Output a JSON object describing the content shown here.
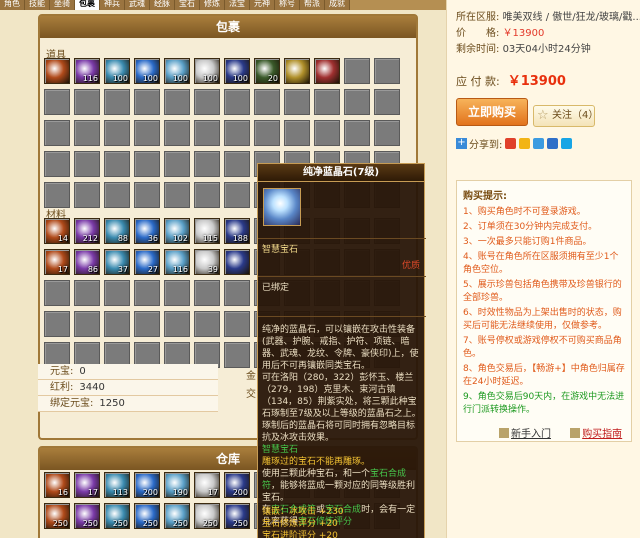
{
  "tabs": [
    "角色",
    "技能",
    "坐骑",
    "包裹",
    "神兵",
    "武魂",
    "经脉",
    "宝石",
    "修炼",
    "法宝",
    "元神",
    "称号",
    "帮派",
    "成就"
  ],
  "active_tab": 3,
  "package": {
    "title": "包裹",
    "label_props": "道具",
    "label_materials": "材料",
    "props_counts": [
      "",
      "116",
      "100",
      "100",
      "100",
      "100",
      "100",
      "20",
      "",
      "",
      "",
      ""
    ],
    "materials_counts": [
      "14",
      "212",
      "88",
      "36",
      "102",
      "115",
      "188",
      "",
      "",
      "",
      "",
      "",
      "17",
      "86",
      "37",
      "27",
      "116",
      "39",
      "",
      "",
      "",
      "",
      "",
      ""
    ],
    "currency": {
      "yuanbao_label": "元宝:",
      "yuanbao": "0",
      "hongli_label": "红利:",
      "hongli": "3440",
      "bind_label": "绑定元宝:",
      "bind": "1250"
    },
    "extra_labels": [
      "金",
      "交"
    ]
  },
  "store": {
    "title": "仓库",
    "counts": [
      "16",
      "17",
      "113",
      "200",
      "190",
      "17",
      "200",
      "",
      "",
      "",
      "",
      "",
      "250",
      "250",
      "250",
      "250",
      "250",
      "250",
      "250",
      "",
      "",
      "",
      "",
      ""
    ]
  },
  "tooltip": {
    "title": "纯净蓝晶石(7级)",
    "subtitle": "智慧宝石",
    "quality": "优质",
    "bind": "已绑定",
    "desc_1": "纯净的蓝晶石，可以镶嵌在攻击性装备(武器、护腕、戒指、护符、项链、暗器、武魂、龙纹、令牌、豪侠印)上，使用后不可再镶嵌同类宝石。",
    "desc_2": "可在洛阳（280，322）彭怀玉、楼兰（279，198）克里木、束河古镇（134，85）荆紫实处，将三颗此种宝石琢制至7级及以上等级的蓝晶石之上。琢制后的蓝晶石将可同时拥有忽略目标抗及冰攻击效果。",
    "gem_type": "智慧宝石",
    "warn": "雕琢过的宝石不能再雕琢。",
    "desc_3_a": "使用三颗此种宝石，和一个",
    "desc_3_b": "，能够将蓝成一颗对应的同等级胜利宝石。",
    "desc_4_a": "在",
    "desc_4_b": "或",
    "desc_4_c": "时，会有一定几率获得",
    "item_fuse": "宝石合成符",
    "item_1": "宝石合成符",
    "item_2": "宝石合成",
    "item_score": "宝石修炼评分",
    "stat_1": "镶嵌：冰攻击 +230",
    "stat_2": "宝石修炼评分 +20",
    "stat_3": "宝石进阶评分 +20"
  },
  "listing": {
    "server_label": "所在区服:",
    "server": "唯美双线 / 傲世/狂龙/玻璃/戳...",
    "price_label": "价　　格:",
    "price": "￥13900",
    "time_label": "剩余时间:",
    "time": "03天04小时24分钟",
    "pay_label": "应 付 款:",
    "pay": "￥13900",
    "buy_label": "立即购买",
    "fav_label": "关注（4）",
    "share_label": "分享到:"
  },
  "buy_tips": {
    "title": "购买提示:",
    "items": [
      "1、购买角色时不可登录游戏。",
      "2、订单须在30分钟内完成支付。",
      "3、一次最多只能订购1件商品。",
      "4、账号在角色所在区服须拥有至少1个角色空位。",
      "5、展示珍兽包括角色携带及珍兽银行的全部珍兽。",
      "6、时效性物品为上架出售时的状态，购买后可能无法继续使用，仅做参考。",
      "7、账号停权或游戏停权不可购买商品角色。",
      "8、角色交易后，【畅游+】中角色归属存在24小时延迟。",
      "9、角色交易后90天内，在游戏中无法进行门派转换操作。"
    ],
    "link_newbie": "新手入门",
    "link_guide": "购买指南"
  },
  "colors": {
    "accent": "#e2731c",
    "price": "#e8300d",
    "tip_green": "#1d9a20"
  }
}
